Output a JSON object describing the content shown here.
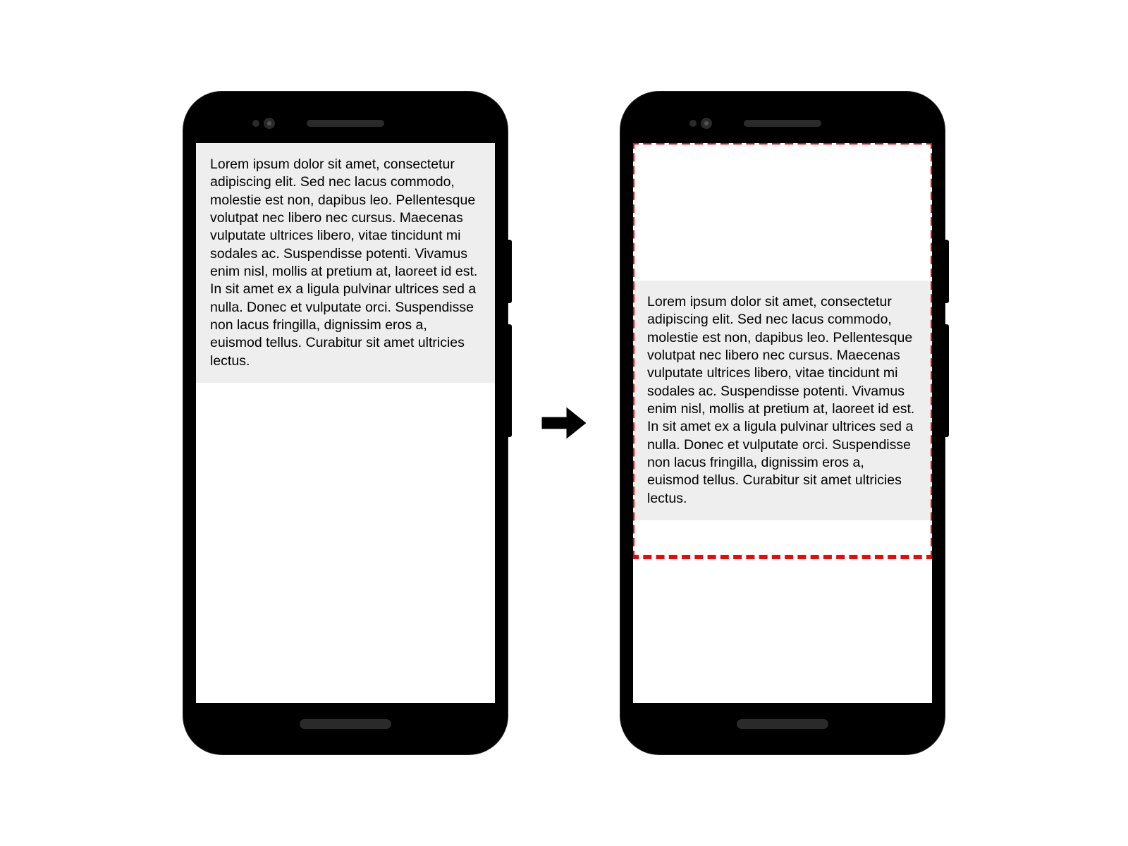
{
  "sample_text": "Lorem ipsum dolor sit amet, consectetur adipiscing elit. Sed nec lacus commodo, molestie est non, dapibus leo. Pellentesque volutpat nec libero nec cursus. Maecenas vulputate ultrices libero, vitae tincidunt mi sodales ac. Suspendisse potenti. Vivamus enim nisl, mollis at pretium at, laoreet id est. In sit amet ex a ligula pulvinar ultrices sed a nulla. Donec et vulputate orci. Suspendisse non lacus fringilla, dignissim eros a, euismod tellus. Curabitur sit amet ultricies lectus."
}
